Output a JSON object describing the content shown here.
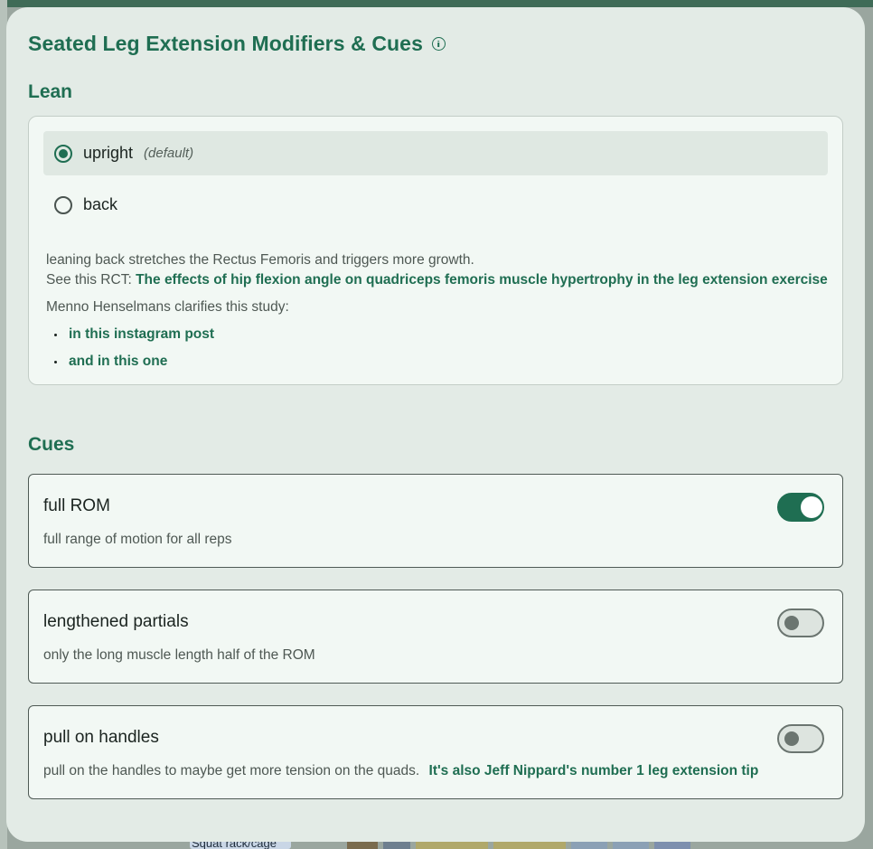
{
  "background": {
    "pill_label": "Squat rack/cage",
    "block_colors": [
      "#7a6b4e",
      "#6e7f8f",
      "#b0a86a",
      "#b0a86a",
      "#8ba0b5",
      "#8ba0b5",
      "#7d8fae",
      "#9aa69f"
    ]
  },
  "modal": {
    "title": "Seated Leg Extension Modifiers & Cues",
    "info_icon": "info-icon"
  },
  "lean": {
    "heading": "Lean",
    "options": [
      {
        "label": "upright",
        "note": "(default)",
        "selected": true
      },
      {
        "label": "back",
        "note": "",
        "selected": false
      }
    ],
    "description_line1": "leaning back stretches the Rectus Femoris and triggers more growth.",
    "rct_prefix": "See this RCT:",
    "rct_link": "The effects of hip flexion angle on quadriceps femoris muscle hypertrophy in the leg extension exercise",
    "menno_text": "Menno Henselmans clarifies this study:",
    "links": [
      "in this instagram post",
      "and in this one"
    ]
  },
  "cues": {
    "heading": "Cues",
    "items": [
      {
        "title": "full ROM",
        "description": "full range of motion for all reps",
        "link": "",
        "enabled": true
      },
      {
        "title": "lengthened partials",
        "description": "only the long muscle length half of the ROM",
        "link": "",
        "enabled": false
      },
      {
        "title": "pull on handles",
        "description": "pull on the handles to maybe get more tension on the quads.",
        "link": "It's also Jeff Nippard's number 1 leg extension tip",
        "enabled": false
      }
    ]
  },
  "colors": {
    "accent": "#1f6e52",
    "modal_bg": "#e3ebe6",
    "card_bg": "#f2f8f4"
  }
}
